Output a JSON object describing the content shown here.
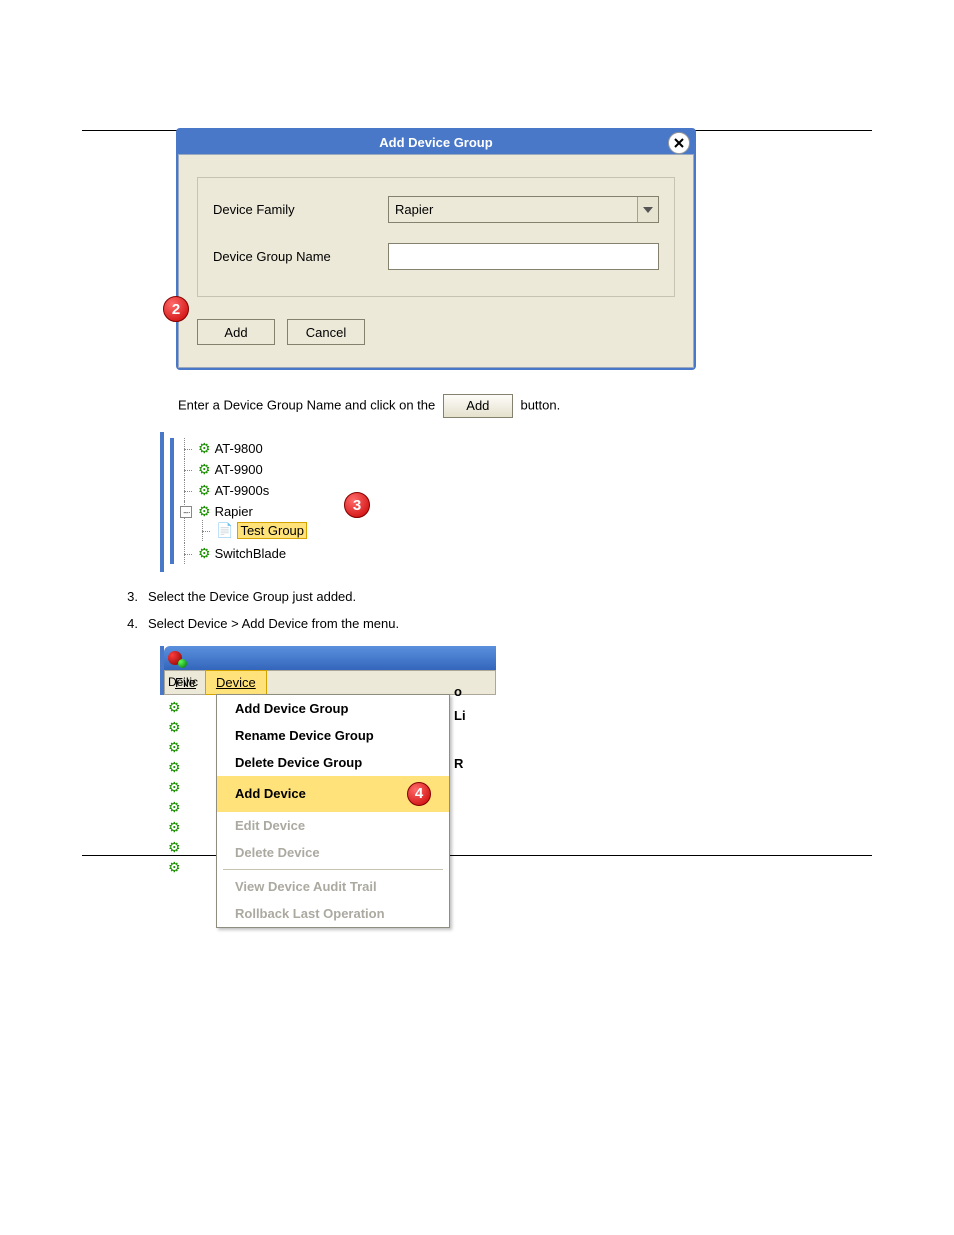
{
  "dialog": {
    "title": "Add Device Group",
    "device_family_label": "Device Family",
    "device_family_value": "Rapier",
    "device_group_name_label": "Device Group Name",
    "device_group_name_value": "",
    "add_btn": "Add",
    "cancel_btn": "Cancel"
  },
  "badges": {
    "step2": "2",
    "step3": "3",
    "step4": "4"
  },
  "para1": "Enter a Device Group Name and click on the  button.",
  "inline_add_btn": "Add",
  "tree": {
    "items": [
      {
        "label": "AT-9800",
        "kind": "group"
      },
      {
        "label": "AT-9900",
        "kind": "group"
      },
      {
        "label": "AT-9900s",
        "kind": "group"
      },
      {
        "label": "Rapier",
        "kind": "group",
        "children": [
          {
            "label": "Test Group",
            "kind": "selected"
          }
        ]
      },
      {
        "label": "SwitchBlade",
        "kind": "group"
      }
    ]
  },
  "steps": [
    {
      "n": "3.",
      "text": "Select the Device Group just added."
    },
    {
      "n": "4.",
      "text": "Select Device > Add Device from the menu."
    }
  ],
  "menubar": {
    "file": "File",
    "device": "Device",
    "panel_label": "Devic"
  },
  "menu": {
    "items": [
      {
        "label": "Add Device Group",
        "state": "enabled"
      },
      {
        "label": "Rename Device Group",
        "state": "enabled"
      },
      {
        "label": "Delete Device Group",
        "state": "enabled"
      },
      {
        "label": "Add Device",
        "state": "selected"
      },
      {
        "label": "Edit Device",
        "state": "disabled"
      },
      {
        "label": "Delete Device",
        "state": "disabled"
      },
      {
        "sep": true
      },
      {
        "label": "View Device Audit Trail",
        "state": "disabled"
      },
      {
        "label": "Rollback Last Operation",
        "state": "disabled"
      }
    ]
  },
  "behind_chars": [
    "o",
    "Li",
    "R"
  ]
}
